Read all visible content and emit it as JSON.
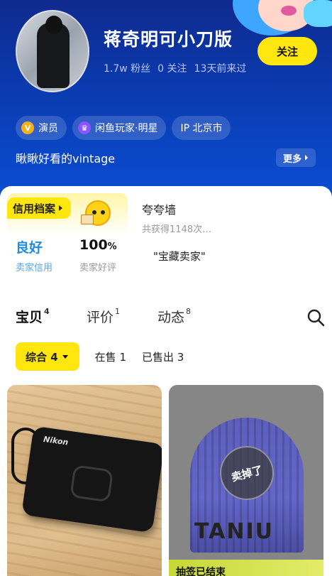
{
  "profile": {
    "name": "蒋奇明可小刀版",
    "fans": "1.7w 粉丝",
    "following": "0 关注",
    "last_seen": "13天前来过",
    "follow_label": "关注",
    "tags": [
      {
        "icon": "V",
        "label": "演员"
      },
      {
        "icon": "♛",
        "label": "闲鱼玩家·明星"
      },
      {
        "label": "IP 北京市"
      }
    ],
    "bio": "瞅瞅好看的vintage",
    "more_label": "更多"
  },
  "credit": {
    "label": "信用档案",
    "level": "良好",
    "level_caption": "卖家信用",
    "rating": "100",
    "rating_unit": "%",
    "rating_caption": "卖家好评",
    "praise_title": "夸夸墙",
    "praise_count": "共获得1148次…",
    "praise_quote": "\"宝藏卖家\""
  },
  "tabs": [
    {
      "label": "宝贝",
      "count": "4"
    },
    {
      "label": "评价",
      "count": "1"
    },
    {
      "label": "动态",
      "count": "8"
    }
  ],
  "filters": {
    "all": "综合 4",
    "on_sale": "在售 1",
    "sold": "已售出 3"
  },
  "products": [
    {
      "brand": "Nikon"
    },
    {
      "stamp": "卖掉了",
      "banner": "抽签已结束",
      "print": "TANIU"
    }
  ]
}
